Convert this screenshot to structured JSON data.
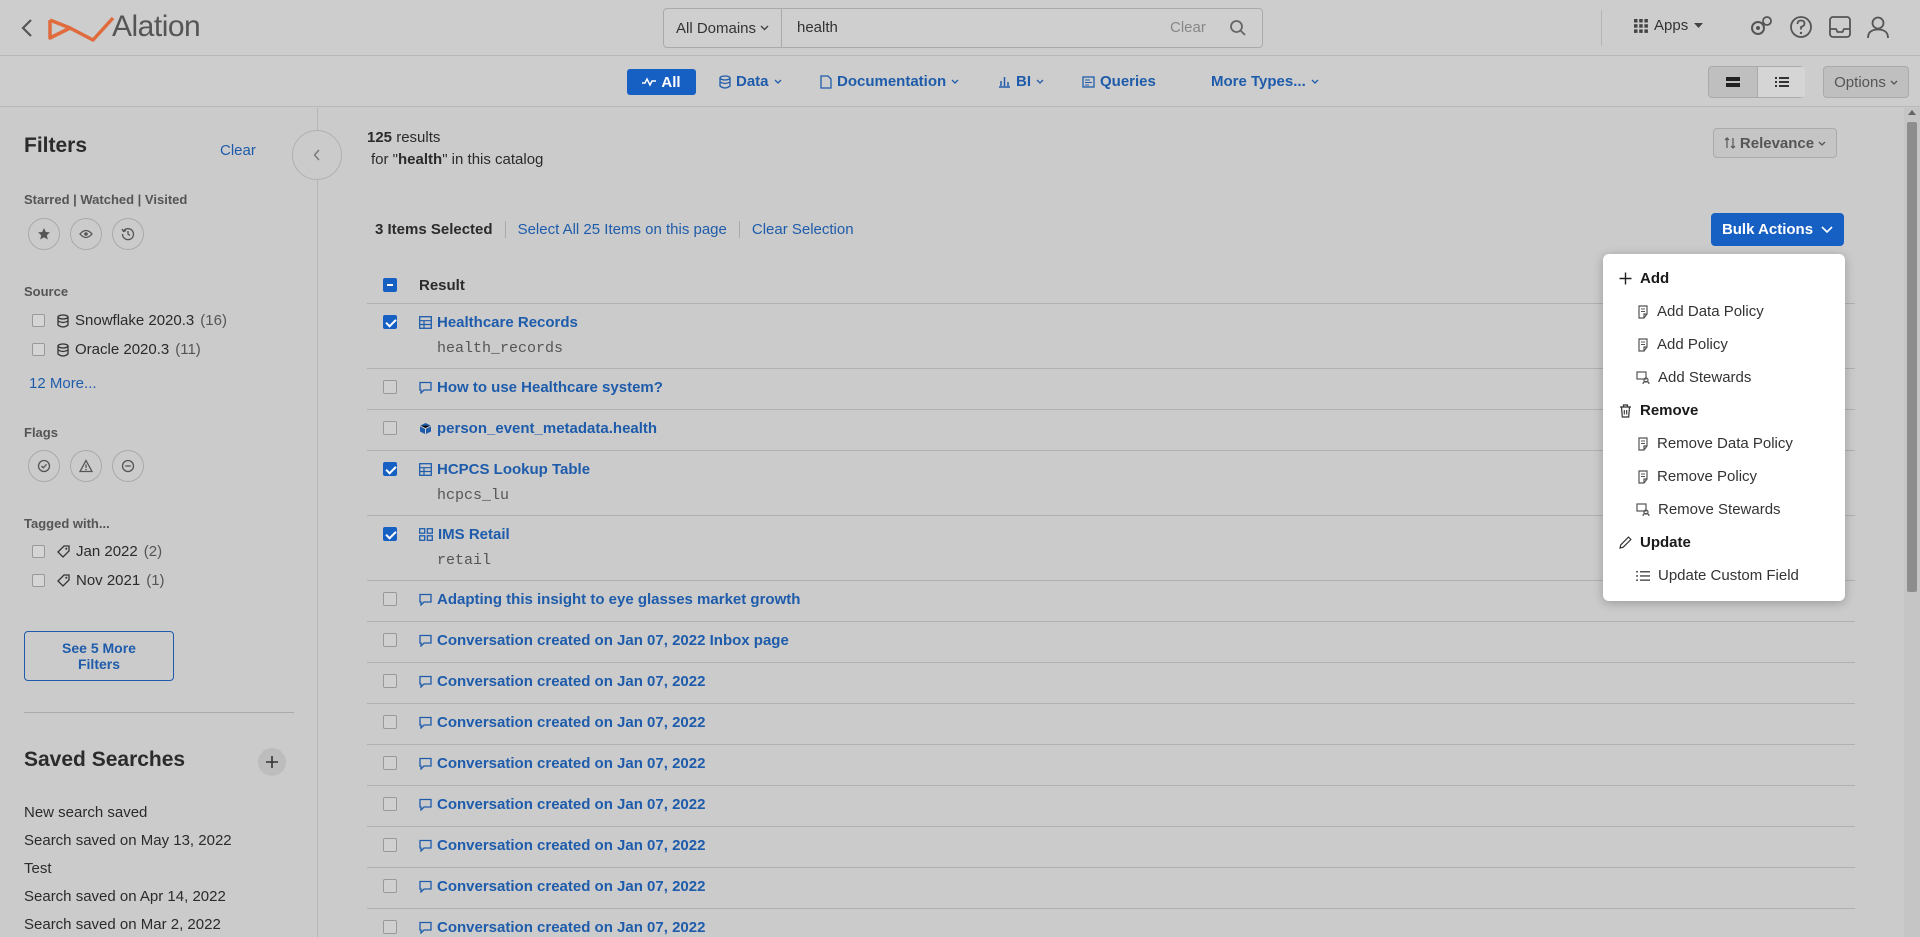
{
  "header": {
    "logo_text": "Alation",
    "search": {
      "domain": "All Domains",
      "query": "health",
      "clear_label": "Clear"
    },
    "apps_label": "Apps"
  },
  "type_filters": {
    "all": "All",
    "data": "Data",
    "documentation": "Documentation",
    "bi": "BI",
    "queries": "Queries",
    "more": "More Types..."
  },
  "options_label": "Options",
  "sidebar": {
    "title": "Filters",
    "clear_label": "Clear",
    "starred_label": "Starred | Watched | Visited",
    "source_label": "Source",
    "sources": [
      {
        "name": "Snowflake 2020.3",
        "count": "(16)"
      },
      {
        "name": "Oracle 2020.3",
        "count": "(11)"
      }
    ],
    "more_sources": "12 More...",
    "flags_label": "Flags",
    "tagged_label": "Tagged with...",
    "tags": [
      {
        "name": "Jan 2022",
        "count": "(2)"
      },
      {
        "name": "Nov 2021",
        "count": "(1)"
      }
    ],
    "see_more": "See 5 More Filters",
    "saved_title": "Saved Searches",
    "saved": [
      "New search saved",
      "Search saved on May 13, 2022",
      "Test",
      "Search saved on Apr 14, 2022",
      "Search saved on Mar 2, 2022"
    ]
  },
  "results": {
    "count": "125",
    "count_suffix": " results",
    "for_prefix": "for \"",
    "query": "health",
    "for_suffix": "\" in this catalog",
    "sort_label": "Relevance",
    "selected_count": "3 Items Selected",
    "select_all": "Select All 25 Items on this page",
    "clear_selection": "Clear Selection",
    "bulk_actions": "Bulk Actions",
    "column_header": "Result",
    "rows": [
      {
        "name": "Healthcare Records",
        "sub": "health_records",
        "icon": "table-icon",
        "checked": true
      },
      {
        "name": "How to use Healthcare system?",
        "sub": "",
        "icon": "conversation-icon",
        "checked": false
      },
      {
        "name": "person_event_metadata.health",
        "sub": "",
        "icon": "cube-icon",
        "checked": false
      },
      {
        "name": "HCPCS Lookup Table",
        "sub": "hcpcs_lu",
        "icon": "table-icon",
        "checked": true
      },
      {
        "name": "IMS Retail",
        "sub": "retail",
        "icon": "schema-icon",
        "checked": true
      },
      {
        "name": "Adapting this insight to eye glasses market growth",
        "sub": "",
        "icon": "conversation-icon",
        "checked": false
      },
      {
        "name": "Conversation created on Jan 07, 2022 Inbox page",
        "sub": "",
        "icon": "conversation-icon",
        "checked": false
      },
      {
        "name": "Conversation created on Jan 07, 2022",
        "sub": "",
        "icon": "conversation-icon",
        "checked": false
      },
      {
        "name": "Conversation created on Jan 07, 2022",
        "sub": "",
        "icon": "conversation-icon",
        "checked": false
      },
      {
        "name": "Conversation created on Jan 07, 2022",
        "sub": "",
        "icon": "conversation-icon",
        "checked": false
      },
      {
        "name": "Conversation created on Jan 07, 2022",
        "sub": "",
        "icon": "conversation-icon",
        "checked": false
      },
      {
        "name": "Conversation created on Jan 07, 2022",
        "sub": "",
        "icon": "conversation-icon",
        "checked": false
      },
      {
        "name": "Conversation created on Jan 07, 2022",
        "sub": "",
        "icon": "conversation-icon",
        "checked": false
      },
      {
        "name": "Conversation created on Jan 07, 2022",
        "sub": "",
        "icon": "conversation-icon",
        "checked": false
      }
    ]
  },
  "bulk_menu": {
    "add": "Add",
    "add_data_policy": "Add Data Policy",
    "add_policy": "Add Policy",
    "add_stewards": "Add Stewards",
    "remove": "Remove",
    "remove_data_policy": "Remove Data Policy",
    "remove_policy": "Remove Policy",
    "remove_stewards": "Remove Stewards",
    "update": "Update",
    "update_custom_field": "Update Custom Field"
  },
  "colors": {
    "accent": "#1660c4",
    "link": "#1e5cab",
    "logo": "#e06b3c"
  }
}
